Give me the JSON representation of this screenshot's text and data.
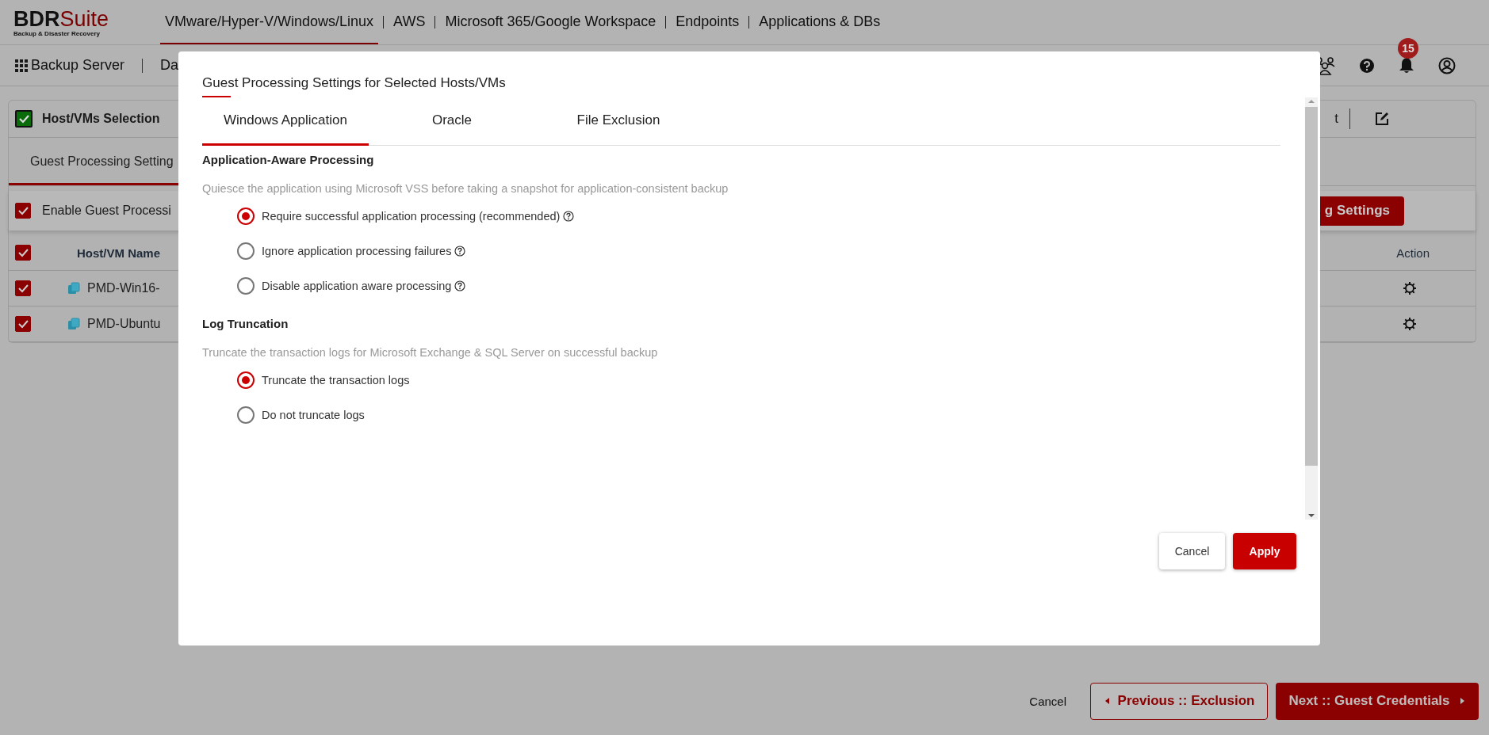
{
  "brand": {
    "name_bold": "BDR",
    "name_light": "Suite",
    "tagline": "Backup & Disaster Recovery"
  },
  "top_nav": [
    {
      "label": "VMware/Hyper-V/Windows/Linux",
      "selected": true
    },
    {
      "label": "AWS",
      "selected": false
    },
    {
      "label": "Microsoft 365/Google Workspace",
      "selected": false
    },
    {
      "label": "Endpoints",
      "selected": false
    },
    {
      "label": "Applications & DBs",
      "selected": false
    }
  ],
  "sub_bar": {
    "items": [
      "Backup Server",
      "Da"
    ],
    "notifications": "15"
  },
  "wizard": {
    "step_header": {
      "label": "Host/VMs Selection",
      "checked": true
    },
    "header_tab_fragment": "t",
    "tab": "Guest Processing Setting",
    "enable": {
      "label": "Enable Guest Processi",
      "checked": true
    },
    "settings_button": "g Settings",
    "table": {
      "select_all_checked": true,
      "columns": [
        "Host/VM Name",
        "Action"
      ],
      "rows": [
        {
          "name": "PMD-Win16-",
          "checked": true
        },
        {
          "name": "PMD-Ubuntu",
          "checked": true
        }
      ]
    }
  },
  "footer": {
    "cancel": "Cancel",
    "previous": "Previous :: Exclusion",
    "next": "Next :: Guest Credentials"
  },
  "modal": {
    "title": "Guest Processing Settings for Selected Hosts/VMs",
    "tabs": [
      {
        "label": "Windows Application",
        "selected": true
      },
      {
        "label": "Oracle",
        "selected": false
      },
      {
        "label": "File Exclusion",
        "selected": false
      }
    ],
    "sections": [
      {
        "heading": "Application-Aware Processing",
        "description": "Quiesce the application using Microsoft VSS before taking a snapshot for application-consistent backup",
        "options": [
          {
            "label": "Require successful application processing (recommended)",
            "selected": true,
            "help": true
          },
          {
            "label": "Ignore application processing failures",
            "selected": false,
            "help": true
          },
          {
            "label": "Disable application aware processing",
            "selected": false,
            "help": true
          }
        ]
      },
      {
        "heading": "Log Truncation",
        "description": "Truncate the transaction logs for Microsoft Exchange & SQL Server on successful backup",
        "options": [
          {
            "label": "Truncate the transaction logs",
            "selected": true
          },
          {
            "label": "Do not truncate logs",
            "selected": false
          }
        ]
      }
    ],
    "buttons": {
      "cancel": "Cancel",
      "apply": "Apply"
    }
  }
}
